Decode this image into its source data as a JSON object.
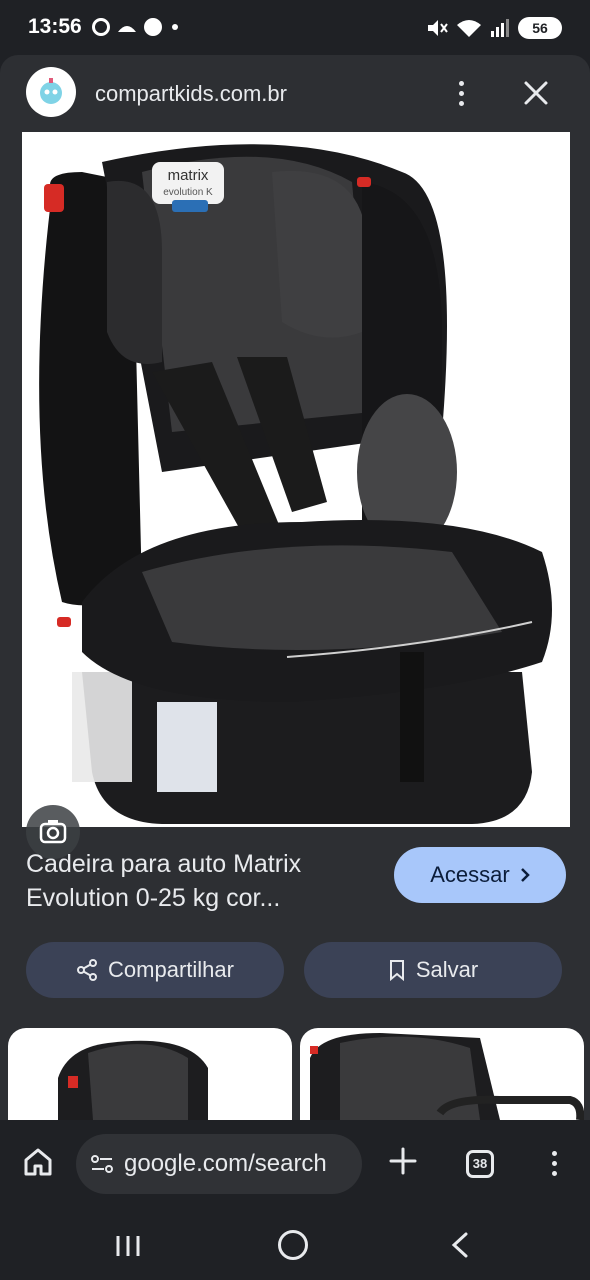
{
  "status_bar": {
    "time": "13:56",
    "battery": "56"
  },
  "site": {
    "name": "compartkids.com.br"
  },
  "product": {
    "title_line1": "Cadeira para auto Matrix",
    "title_line2": "Evolution 0-25 kg cor...",
    "image_brand_line1": "matrix",
    "image_brand_line2": "evolution K"
  },
  "actions": {
    "visit_label": "Acessar",
    "share_label": "Compartilhar",
    "save_label": "Salvar"
  },
  "toolbar": {
    "url": "google.com/search",
    "tab_count": "38"
  },
  "colors": {
    "sheet_bg": "#2d2f33",
    "visit_button": "#a8c7fa",
    "action_button": "#3b4256"
  }
}
